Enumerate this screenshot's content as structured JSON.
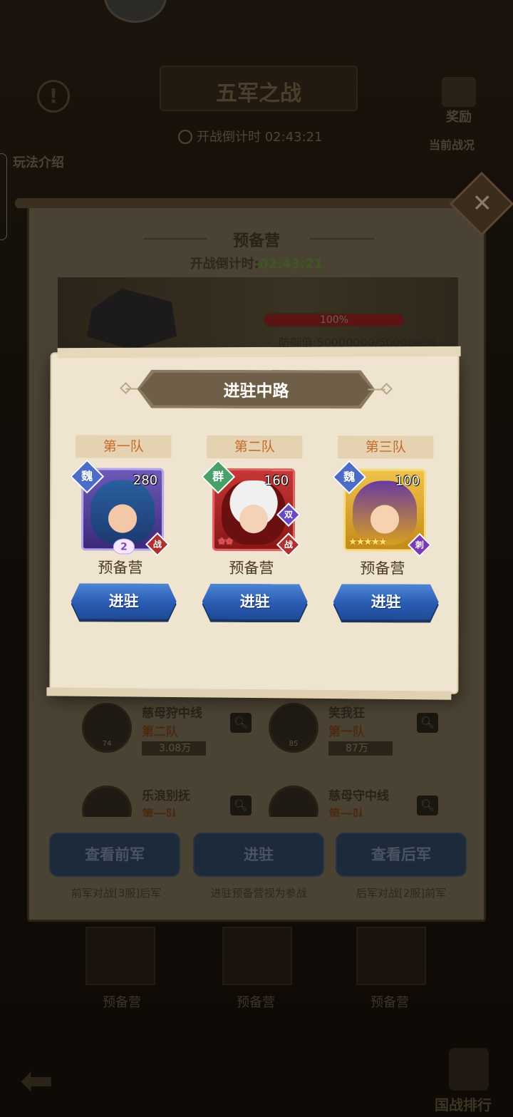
{
  "background": {
    "title": "五军之战",
    "countdown_label": "开战倒计时",
    "countdown_value": "02:43:21",
    "rules_label": "玩法介绍",
    "reward_label": "奖励",
    "status_label": "当前战况",
    "rank_label": "国战排行",
    "cards": [
      {
        "label": "预备营"
      },
      {
        "label": "预备营"
      },
      {
        "label": "预备营"
      }
    ]
  },
  "reserve": {
    "title": "预备营",
    "countdown_label": "开战倒计时:",
    "countdown_value": "02:43:21",
    "hp_percent_text": "100%",
    "hp_fraction": 1.0,
    "defense_text": "防御值:50000000/50000000",
    "players": [
      {
        "name": "慈母狩中线",
        "team": "第二队",
        "power": "3.08万",
        "level": "74"
      },
      {
        "name": "笑我狂",
        "team": "第一队",
        "power": "87万",
        "level": "85"
      },
      {
        "name": "乐浪别抚",
        "team": "第一队",
        "power": "",
        "level": ""
      },
      {
        "name": "慈母守中线",
        "team": "第一队",
        "power": "",
        "level": ""
      }
    ],
    "buttons": {
      "view_front": "查看前军",
      "deploy": "进驻",
      "view_rear": "查看后军"
    },
    "captions": {
      "front": "前军对战[3服]后军",
      "deploy": "进驻预备营视为参战",
      "rear": "后军对战[2服]前军"
    }
  },
  "dialog": {
    "title": "进驻中路",
    "teams": [
      {
        "label": "第一队",
        "faction": "魏",
        "level": "280",
        "role": "战",
        "awaken": "2",
        "stars": "",
        "status": "预备营",
        "button": "进驻",
        "color": "#6d58b8"
      },
      {
        "label": "第二队",
        "faction": "群",
        "level": "160",
        "role": "战",
        "secondary_role": "双",
        "stars": "★★",
        "status": "预备营",
        "button": "进驻",
        "color": "#c83636"
      },
      {
        "label": "第三队",
        "faction": "魏",
        "level": "100",
        "role": "刺",
        "stars": "★★★★★",
        "status": "预备营",
        "button": "进驻",
        "color": "#f0c24a"
      }
    ]
  },
  "close_icon": "close-icon"
}
